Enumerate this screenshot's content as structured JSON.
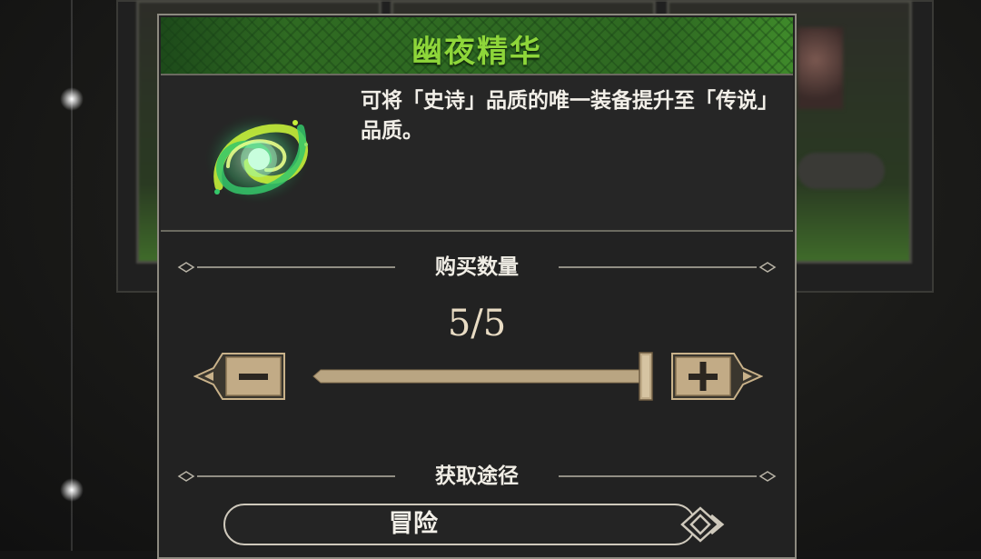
{
  "item": {
    "name": "幽夜精华",
    "description": "可将「史诗」品质的唯一装备提升至「传说」品质。",
    "icon": "green-swirl-essence-icon"
  },
  "purchase": {
    "section_title": "购买数量",
    "quantity_text": "5/5",
    "quantity": 5,
    "max": 5,
    "decrease_icon": "minus-icon",
    "increase_icon": "plus-icon"
  },
  "acquire": {
    "section_title": "获取途径",
    "source_label": "冒险",
    "go_icon": "arrow-right-icon"
  },
  "colors": {
    "title_green": "#8ed63a",
    "gold": "#c9b28a",
    "panel_bg": "#222222"
  }
}
